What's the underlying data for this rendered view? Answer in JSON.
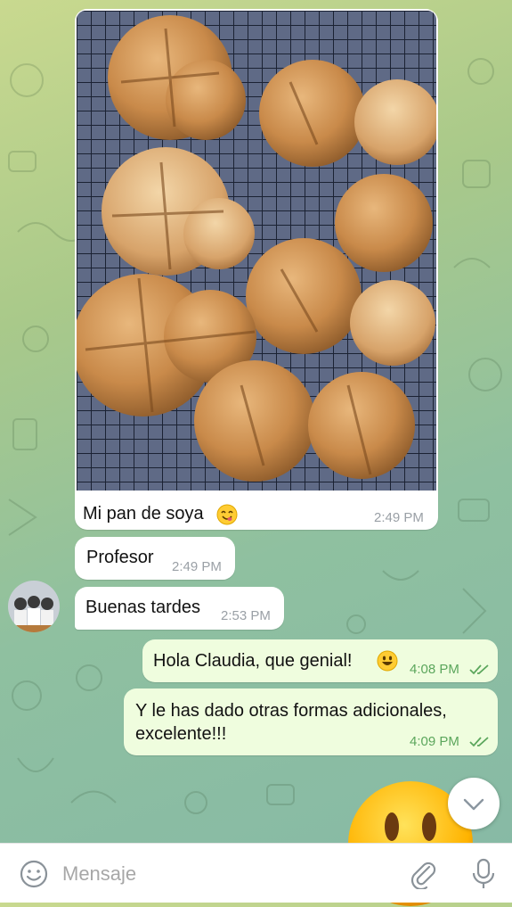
{
  "chat": {
    "messages": [
      {
        "sender": "incoming",
        "text": "Mi pan de soya",
        "emoji": "yum-emoji",
        "time": "2:49 PM",
        "has_photo": true
      },
      {
        "sender": "incoming",
        "text": "Profesor",
        "time": "2:49 PM"
      },
      {
        "sender": "incoming",
        "text": "Buenas tardes",
        "time": "2:53 PM"
      },
      {
        "sender": "outgoing",
        "text": "Hola Claudia, que genial!",
        "emoji": "smiley-emoji",
        "time": "4:08 PM",
        "status": "read"
      },
      {
        "sender": "outgoing",
        "text_line1": "Y le has dado otras formas adicionales,",
        "text_line2": "excelente!!!",
        "time": "4:09 PM",
        "status": "read"
      }
    ]
  },
  "composer": {
    "placeholder": "Mensaje",
    "emoji_icon": "emoji-icon",
    "attach_icon": "paperclip-icon",
    "mic_icon": "microphone-icon"
  },
  "colors": {
    "outgoing_bubble": "#effdde",
    "incoming_bubble": "#ffffff",
    "read_tick": "#5ba65c"
  }
}
